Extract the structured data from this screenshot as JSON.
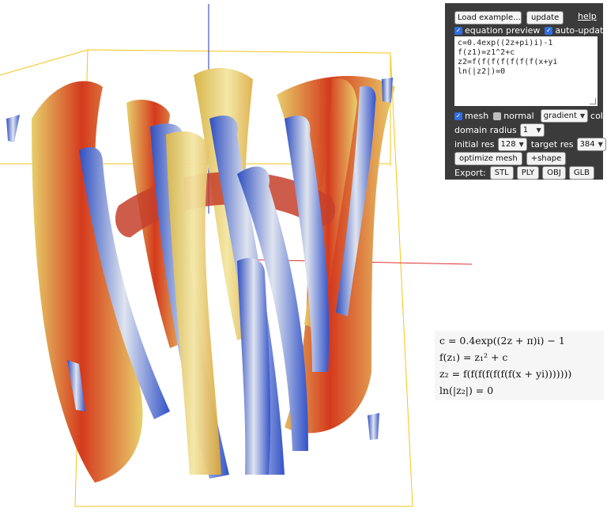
{
  "panel": {
    "examples_label": "Load example...",
    "update_label": "update",
    "help_label": "help",
    "equation_preview_label": "equation preview",
    "auto_update_label": "auto-update",
    "equation_lines": [
      "c=0.4exp((2z+pi)i)-1",
      "f(z1)=z1^2+c",
      "z2=f(f(f(f(f(f(f(x+yi",
      "ln(|z2|)=0"
    ],
    "mesh_label": "mesh",
    "normal_label": "normal",
    "color_mode": "gradient",
    "color_label": "color",
    "domain_radius_label": "domain radius",
    "domain_radius_value": "1",
    "initial_res_label": "initial res",
    "initial_res_value": "128",
    "target_res_label": "target res",
    "target_res_value": "384",
    "optimize_label": "optimize mesh",
    "shape_label": "+shape",
    "export_label": "Export:",
    "export_buttons": [
      "STL",
      "PLY",
      "OBJ",
      "GLB"
    ]
  },
  "checks": {
    "equation_preview": true,
    "auto_update": true,
    "mesh": true,
    "normal": false
  },
  "preview": [
    "c = 0.4exp((2z + π)i) − 1",
    "f(z₁) = z₁² + c",
    "z₂ = f(f(f(f(f(f(f(x + yi)))))))",
    "ln(|z₂|) = 0"
  ],
  "colors": {
    "panel_bg": "#3b3b3b",
    "box_edge": "#f5c518",
    "x_axis": "#e03030",
    "y_axis": "#2030c0",
    "tube_blue": "#3a5fd0",
    "tube_red": "#d23a1e",
    "tube_yellow": "#e8c95a"
  }
}
